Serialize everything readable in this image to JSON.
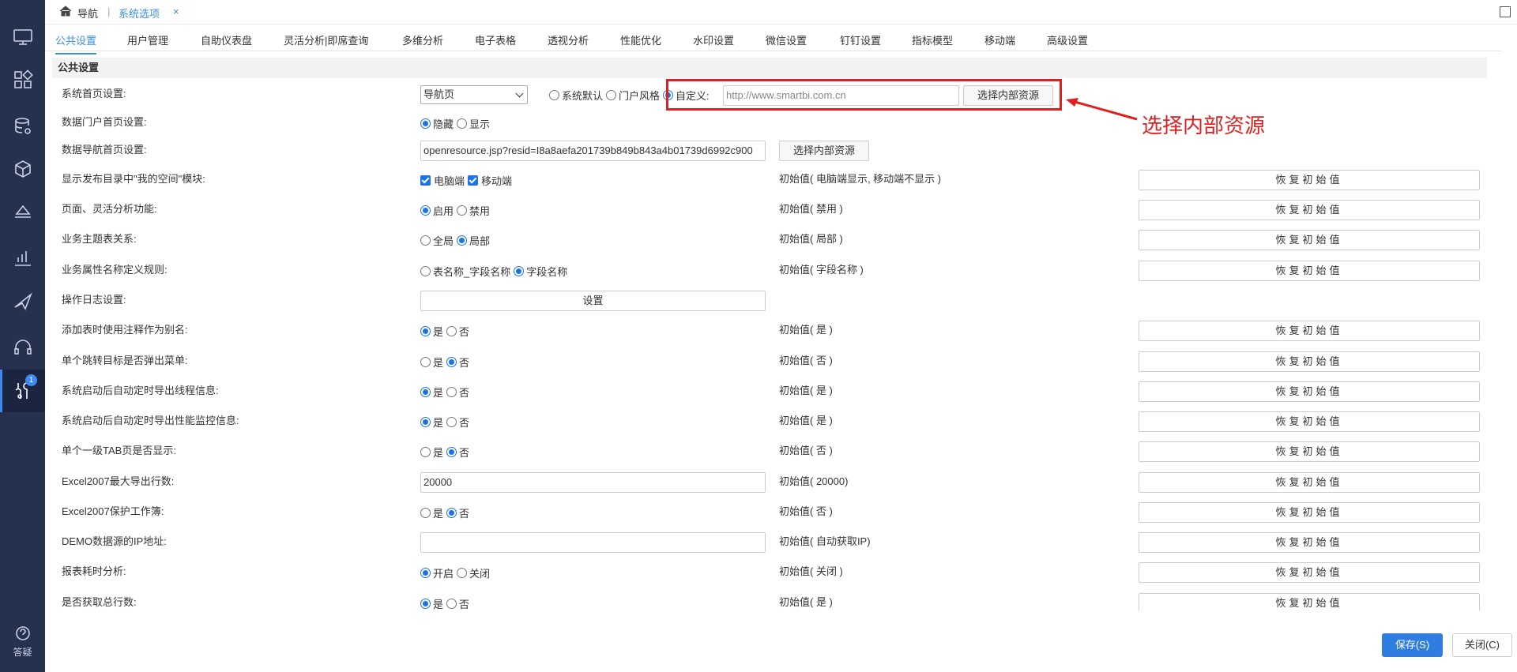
{
  "breadcrumb": {
    "home": "导航",
    "sep": "|",
    "current_tab": "系统选项",
    "close": "×"
  },
  "tabs": [
    "公共设置",
    "用户管理",
    "自助仪表盘",
    "灵活分析|即席查询",
    "多维分析",
    "电子表格",
    "透视分析",
    "性能优化",
    "水印设置",
    "微信设置",
    "钉钉设置",
    "指标模型",
    "移动端",
    "高级设置"
  ],
  "section_title": "公共设置",
  "sidebar": {
    "badge": "1",
    "help_label": "答疑"
  },
  "reset_label": "恢复初始值",
  "rows": {
    "home": {
      "label": "系统首页设置:",
      "select": "导航页",
      "opt1": "系统默认",
      "opt2": "门户风格",
      "opt3": "自定义:",
      "url_placeholder": "http://www.smartbi.com.cn",
      "btn": "选择内部资源"
    },
    "portal": {
      "label": "数据门户首页设置:",
      "opt1": "隐藏",
      "opt2": "显示"
    },
    "nav": {
      "label": "数据导航首页设置:",
      "value": "openresource.jsp?resid=I8a8aefa201739b849b843a4b01739d6992c900",
      "btn": "选择内部资源"
    },
    "myspace": {
      "label": "显示发布目录中\"我的空间\"模块:",
      "opt1": "电脑端",
      "opt2": "移动端",
      "init": "初始值( 电脑端显示, 移动端不显示 )"
    },
    "flex": {
      "label": "页面、灵活分析功能:",
      "opt1": "启用",
      "opt2": "禁用",
      "init": "初始值( 禁用 )"
    },
    "topic": {
      "label": "业务主题表关系:",
      "opt1": "全局",
      "opt2": "局部",
      "init": "初始值( 局部 )"
    },
    "attr": {
      "label": "业务属性名称定义规则:",
      "opt1": "表名称_字段名称",
      "opt2": "字段名称",
      "init": "初始值( 字段名称 )"
    },
    "oplog": {
      "label": "操作日志设置:",
      "btn": "设置"
    },
    "alias": {
      "label": "添加表时使用注释作为别名:",
      "opt1": "是",
      "opt2": "否",
      "init": "初始值( 是 )"
    },
    "jump": {
      "label": "单个跳转目标是否弹出菜单:",
      "opt1": "是",
      "opt2": "否",
      "init": "初始值( 否 )"
    },
    "thread": {
      "label": "系统启动后自动定时导出线程信息:",
      "opt1": "是",
      "opt2": "否",
      "init": "初始值( 是 )"
    },
    "perf": {
      "label": "系统启动后自动定时导出性能监控信息:",
      "opt1": "是",
      "opt2": "否",
      "init": "初始值( 是 )"
    },
    "tab1": {
      "label": "单个一级TAB页是否显示:",
      "opt1": "是",
      "opt2": "否",
      "init": "初始值( 否 )"
    },
    "excelrows": {
      "label": "Excel2007最大导出行数:",
      "value": "20000",
      "init": "初始值( 20000)"
    },
    "excelprot": {
      "label": "Excel2007保护工作簿:",
      "opt1": "是",
      "opt2": "否",
      "init": "初始值( 否 )"
    },
    "demoip": {
      "label": "DEMO数据源的IP地址:",
      "value": "",
      "init": "初始值( 自动获取IP)"
    },
    "timing": {
      "label": "报表耗时分析:",
      "opt1": "开启",
      "opt2": "关闭",
      "init": "初始值( 关闭 )"
    },
    "total": {
      "label": "是否获取总行数:",
      "opt1": "是",
      "opt2": "否",
      "init": "初始值( 是 )"
    }
  },
  "callout": "选择内部资源",
  "footer": {
    "save": "保存(S)",
    "close": "关闭(C)"
  },
  "colors": {
    "sidebar": "#263150",
    "accent": "#3a8ee6",
    "highlight": "#e02020",
    "save": "#2f7de1"
  }
}
